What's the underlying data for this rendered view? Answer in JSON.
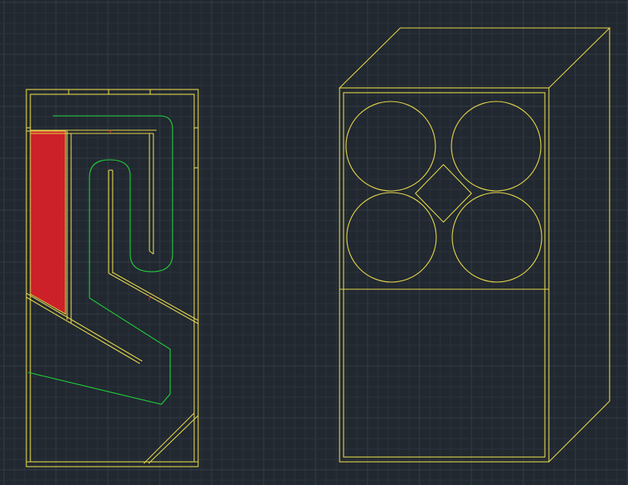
{
  "colors": {
    "background": "#212830",
    "grid_minor": "#2a323c",
    "grid_major": "#343d48",
    "outline": "#e5d64a",
    "path_line": "#1fd23a",
    "fill_region": "#cc2128",
    "marker": "#e02020"
  }
}
